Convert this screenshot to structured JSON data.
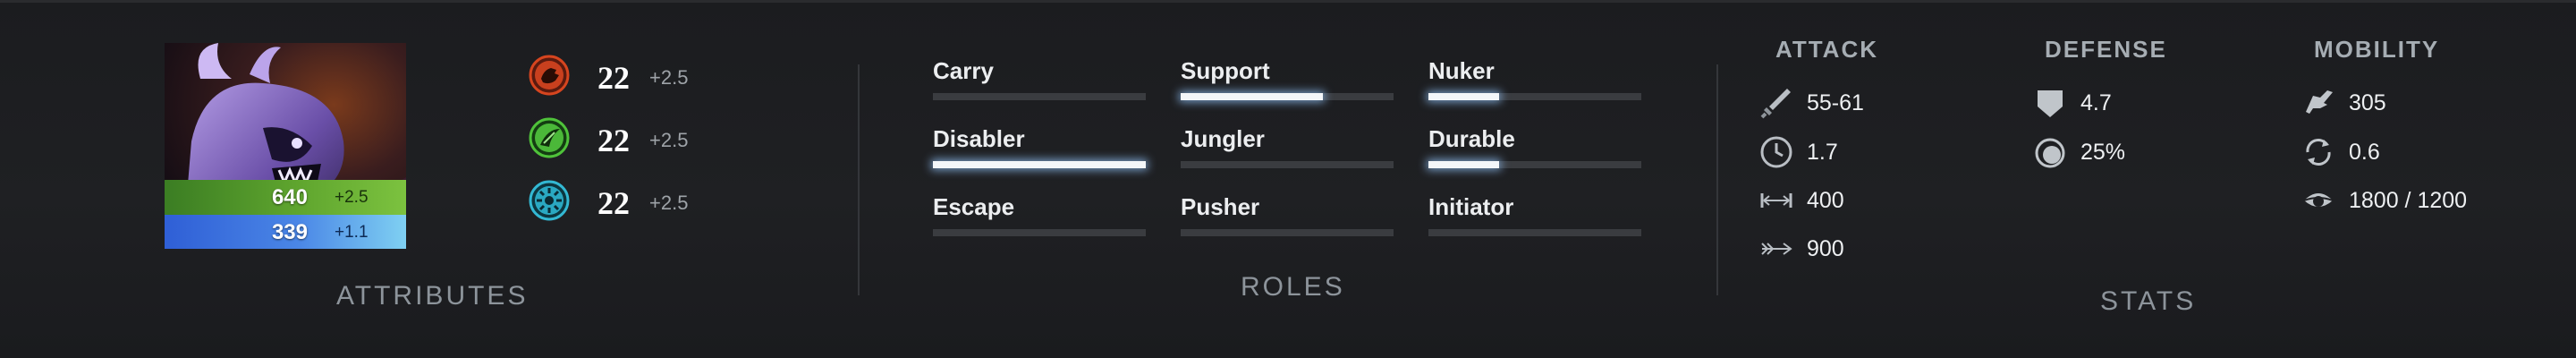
{
  "attributes": {
    "title": "ATTRIBUTES",
    "health": {
      "value": "640",
      "regen": "+2.5"
    },
    "mana": {
      "value": "339",
      "regen": "+1.1"
    },
    "strength": {
      "value": "22",
      "gain": "+2.5",
      "icon": "strength-icon",
      "color": "#c9401e"
    },
    "agility": {
      "value": "22",
      "gain": "+2.5",
      "icon": "agility-icon",
      "color": "#4bb839"
    },
    "intelligence": {
      "value": "22",
      "gain": "+2.5",
      "icon": "intelligence-icon",
      "color": "#2aa8c2"
    }
  },
  "roles": {
    "title": "ROLES",
    "items": [
      {
        "name": "Carry",
        "level": 0.0
      },
      {
        "name": "Support",
        "level": 0.67
      },
      {
        "name": "Nuker",
        "level": 0.33
      },
      {
        "name": "Disabler",
        "level": 1.0
      },
      {
        "name": "Jungler",
        "level": 0.0
      },
      {
        "name": "Durable",
        "level": 0.33
      },
      {
        "name": "Escape",
        "level": 0.0
      },
      {
        "name": "Pusher",
        "level": 0.0
      },
      {
        "name": "Initiator",
        "level": 0.0
      }
    ]
  },
  "stats": {
    "title": "STATS",
    "attack": {
      "header": "ATTACK",
      "damage": "55-61",
      "attack_time": "1.7",
      "attack_range": "400",
      "projectile_speed": "900"
    },
    "defense": {
      "header": "DEFENSE",
      "armor": "4.7",
      "magic_resist": "25%"
    },
    "mobility": {
      "header": "MOBILITY",
      "move_speed": "305",
      "turn_rate": "0.6",
      "vision": "1800 / 1200"
    }
  },
  "colors": {
    "accent_glow": "#9cc8ff",
    "health_bar": "#5fa52e",
    "mana_bar": "#4a86e6"
  }
}
